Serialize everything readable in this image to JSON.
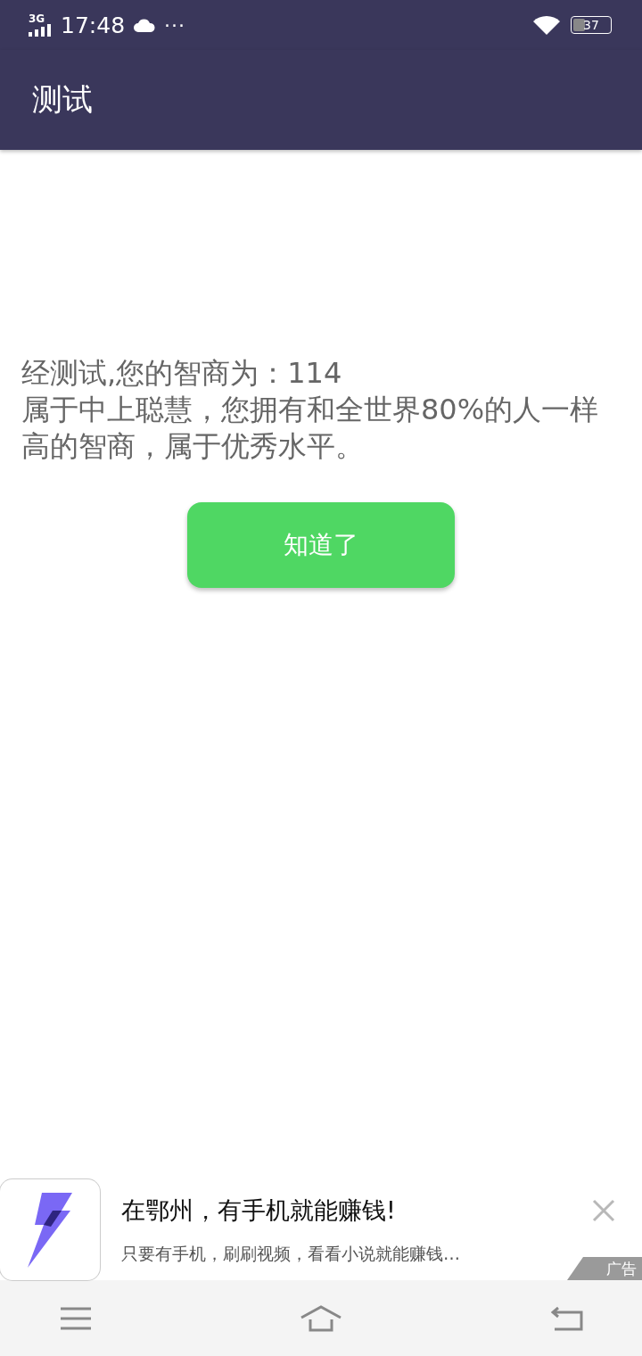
{
  "status_bar": {
    "network": "3G",
    "time": "17:48",
    "more": "···",
    "battery": "37"
  },
  "app_bar": {
    "title": "测试"
  },
  "result": {
    "lines": [
      "经测试,您的智商为：114",
      "属于中上聪慧，您拥有和全世界80%的人一样高的智商，属于优秀水平。"
    ]
  },
  "confirm_button": {
    "label": "知道了"
  },
  "ad": {
    "title": "在鄂州，有手机就能赚钱!",
    "description": "只要有手机，刷刷视频，看看小说就能赚钱…",
    "tag": "广告"
  }
}
